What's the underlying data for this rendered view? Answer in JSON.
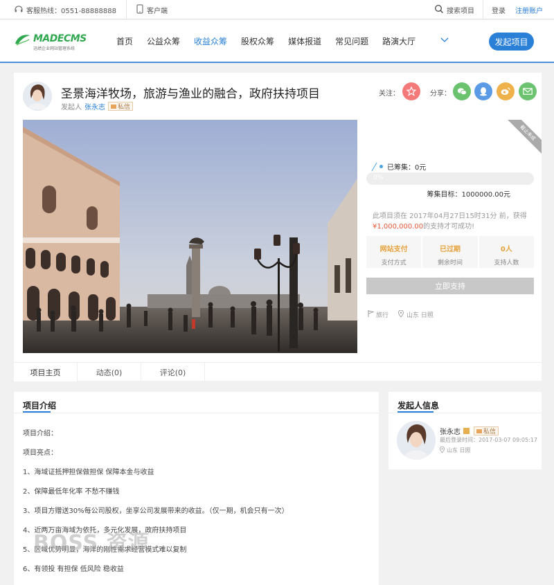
{
  "topbar": {
    "hotline": "客服热线：0551-88888888",
    "client": "客户端",
    "search": "搜索项目",
    "login": "登录",
    "register": "注册账户"
  },
  "header": {
    "logo_brand": "MADECMS",
    "logo_sub": "迅绩企业网站管理系统",
    "nav": [
      "首页",
      "公益众筹",
      "收益众筹",
      "股权众筹",
      "媒体报道",
      "常见问题",
      "路演大厅"
    ],
    "active_nav": "收益众筹",
    "launch_button": "发起项目",
    "accent": "#2a7fd6"
  },
  "project": {
    "title": "圣景海洋牧场，旅游与渔业的融合，政府扶持项目",
    "sponsor_label": "发起人",
    "sponsor_name": "张永志",
    "message_tag": "私信",
    "follow_label": "关注：",
    "share_label": "分享：",
    "ribbon": "截止未成",
    "raised": "已筹集：0元",
    "progress_pct": "0%",
    "progress_value": 0,
    "goal": "筹集目标：1000000.00元",
    "note_prefix": "此项目须在 2017年04月27日15时31分 前，获得",
    "note_amount": "¥1,000,000.00",
    "note_suffix": "的支持才可成功!",
    "stats": [
      {
        "value": "网站支付",
        "label": "支付方式"
      },
      {
        "value": "已过期",
        "label": "剩余时间"
      },
      {
        "value": "0人",
        "label": "支持人数"
      }
    ],
    "support_button": "立即支持",
    "category": "旅行",
    "location": "山东 日照"
  },
  "tabs": [
    "项目主页",
    "动态(0)",
    "评论(0)"
  ],
  "intro": {
    "title": "项目介绍",
    "lines": [
      "项目介绍：",
      "项目亮点：",
      "1、海域证抵押担保做担保 保障本金与收益",
      "2、保障最低年化率 不愁不赚钱",
      "3、项目方赠送30%每公司股权，坐享公司发展带来的收益。（仅一期，机会只有一次）",
      "4、近两万亩海域为依托，多元化发展，政府扶持项目",
      "5、区域优势明显，海洋的刚性需求经营模式难以复制",
      "6、有领投 有担保 低风险 稳收益"
    ]
  },
  "watermark": "BOSS 资源",
  "sponsor_card": {
    "title": "发起人信息",
    "name": "张永志",
    "message_tag": "私信",
    "last_login": "最后登录时间：2017-03-07 09:05:17",
    "location": "山东 日照"
  },
  "icons": {
    "follow": "star-icon",
    "share": [
      "wechat-icon",
      "qq-icon",
      "weibo-icon",
      "email-icon"
    ]
  }
}
